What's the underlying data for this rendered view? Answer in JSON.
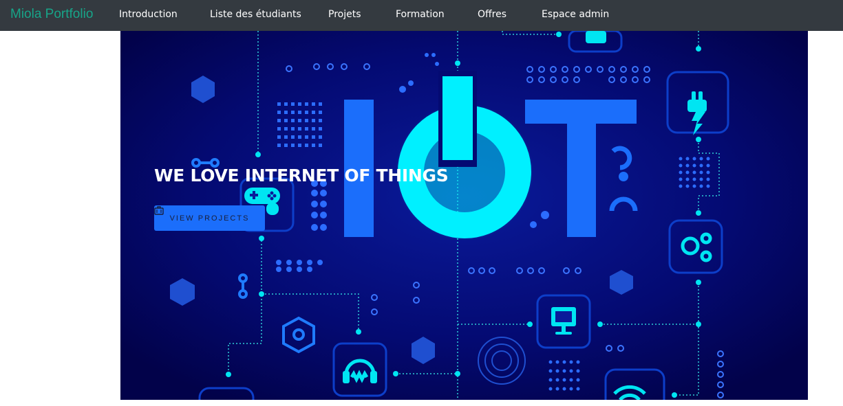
{
  "navbar": {
    "brand": "Miola Portfolio",
    "links": [
      {
        "label": "Introduction"
      },
      {
        "label": "Liste des étudiants"
      },
      {
        "label": "Projets"
      },
      {
        "label": "Formation"
      },
      {
        "label": "Offres"
      },
      {
        "label": "Espace admin"
      }
    ]
  },
  "hero": {
    "title": "WE LOVE INTERNET OF THINGS",
    "button_label": "VIEW PROJECTS",
    "button_icon": "briefcase-icon",
    "image_text": "IOT"
  },
  "colors": {
    "navbar_bg": "#343a40",
    "brand": "#17a589",
    "hero_bg": "#03045e",
    "accent_cyan": "#00f0ff",
    "accent_blue": "#1b6efb"
  }
}
